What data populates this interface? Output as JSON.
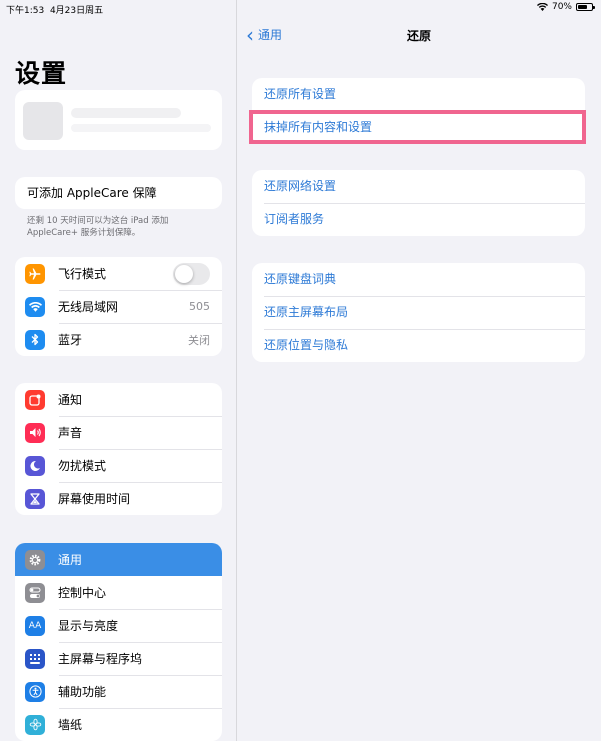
{
  "status_bar": {
    "time": "下午1:53",
    "date": "4月23日周五",
    "battery": "70%",
    "battery_level": 0.7
  },
  "sidebar": {
    "title": "设置",
    "applecare": {
      "title": "可添加 AppleCare 保障",
      "note": "还剩 10 天时间可以为这台 iPad 添加 AppleCare+ 服务计划保障。"
    },
    "group1": [
      {
        "label": "飞行模式",
        "icon": "airplane-icon",
        "color": "#ff9500",
        "toggle_on": false
      },
      {
        "label": "无线局域网",
        "icon": "wifi-icon",
        "color": "#1e8cf0",
        "value": "505"
      },
      {
        "label": "蓝牙",
        "icon": "bluetooth-icon",
        "color": "#1e8cf0",
        "value": "关闭"
      }
    ],
    "group2": [
      {
        "label": "通知",
        "icon": "notifications-icon",
        "color": "#ff3b30"
      },
      {
        "label": "声音",
        "icon": "sound-icon",
        "color": "#ff2d55"
      },
      {
        "label": "勿扰模式",
        "icon": "moon-icon",
        "color": "#5856d6"
      },
      {
        "label": "屏幕使用时间",
        "icon": "hourglass-icon",
        "color": "#5856d6"
      }
    ],
    "group3": [
      {
        "label": "通用",
        "icon": "gear-icon",
        "color": "#8e8e93",
        "selected": true
      },
      {
        "label": "控制中心",
        "icon": "toggles-icon",
        "color": "#8e8e93"
      },
      {
        "label": "显示与亮度",
        "icon": "display-icon",
        "color": "#1e7fe6",
        "glyph": "AA"
      },
      {
        "label": "主屏幕与程序坞",
        "icon": "home-grid-icon",
        "color": "#2a55c8"
      },
      {
        "label": "辅助功能",
        "icon": "accessibility-icon",
        "color": "#1e7fe6"
      },
      {
        "label": "墙纸",
        "icon": "wallpaper-icon",
        "color": "#30b0d8"
      }
    ]
  },
  "detail": {
    "back_label": "通用",
    "title": "还原",
    "group1": [
      "还原所有设置",
      "抹掉所有内容和设置"
    ],
    "group2": [
      "还原网络设置",
      "订阅者服务"
    ],
    "group3": [
      "还原键盘词典",
      "还原主屏幕布局",
      "还原位置与隐私"
    ],
    "highlighted_item": "抹掉所有内容和设置",
    "highlight_color": "#f0658f"
  }
}
